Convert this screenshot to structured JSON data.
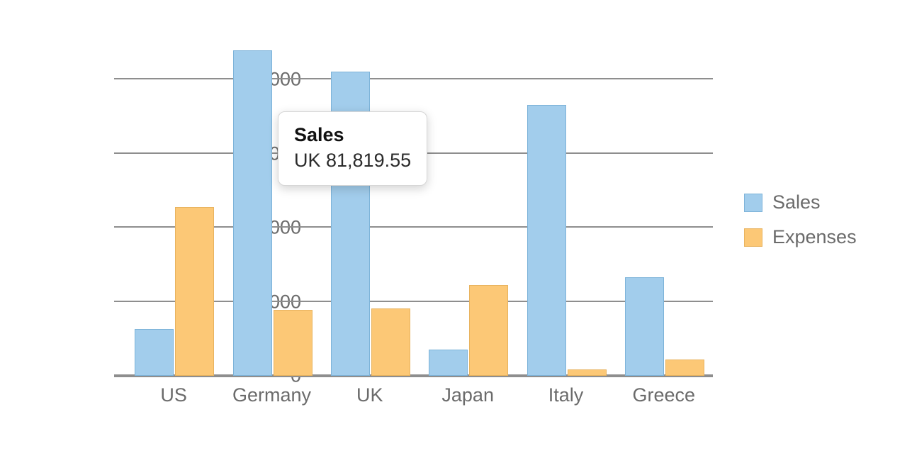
{
  "chart_data": {
    "type": "bar",
    "categories": [
      "US",
      "Germany",
      "UK",
      "Japan",
      "Italy",
      "Greece"
    ],
    "series": [
      {
        "name": "Sales",
        "color": "#a2cdec",
        "border": "#7db3d9",
        "values": [
          12200,
          87500,
          81819.55,
          6800,
          72700,
          26200
        ]
      },
      {
        "name": "Expenses",
        "color": "#fcc876",
        "border": "#e8b35f",
        "values": [
          45200,
          17400,
          17900,
          24200,
          1300,
          4100
        ]
      }
    ],
    "xlabel": "",
    "ylabel": "",
    "ylim": [
      0,
      90000
    ],
    "yticks": [
      0,
      20000,
      40000,
      60000,
      80000
    ],
    "ytick_labels": [
      "0",
      "20,000",
      "40,000",
      "60,000",
      "80,000"
    ]
  },
  "legend": {
    "items": [
      {
        "label": "Sales"
      },
      {
        "label": "Expenses"
      }
    ]
  },
  "tooltip": {
    "title": "Sales",
    "body": "UK 81,819.55"
  }
}
